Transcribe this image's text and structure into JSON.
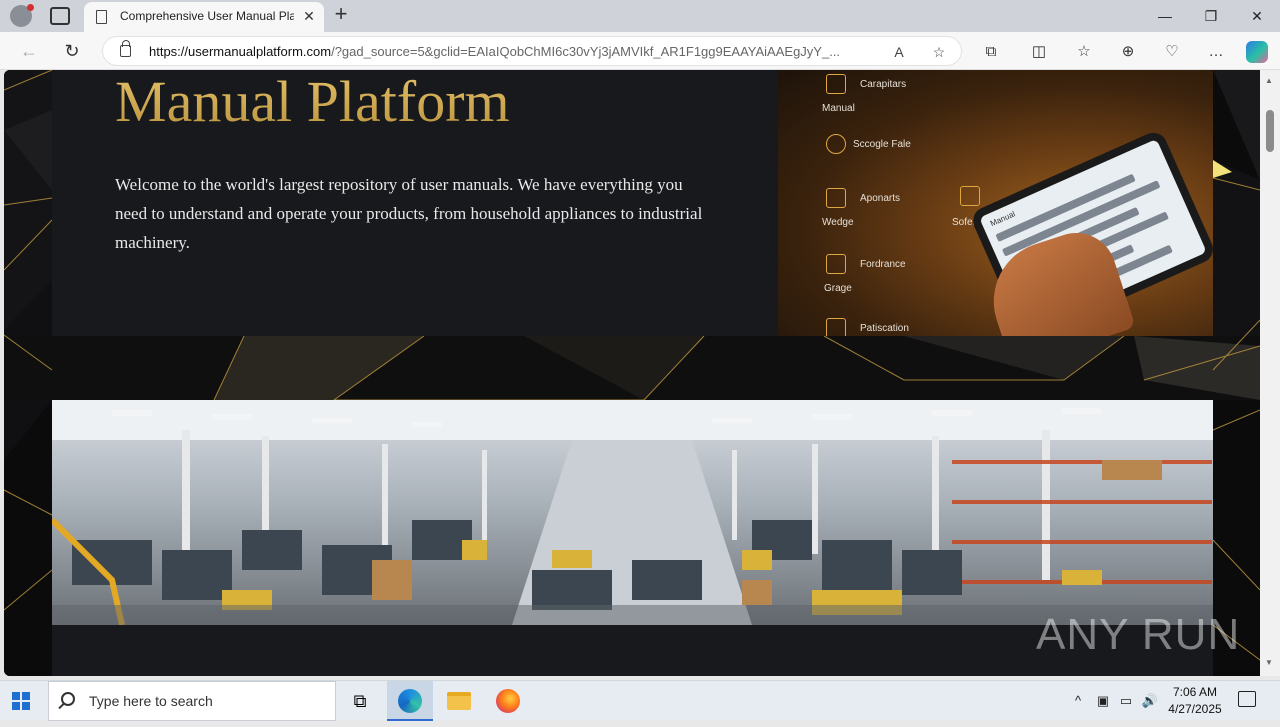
{
  "browser": {
    "tab_title": "Comprehensive User Manual Platform",
    "tab_close": "✕",
    "new_tab": "+",
    "url_host": "https://usermanualplatform.com",
    "url_rest": "/?gad_source=5&gclid=EAIaIQobChMI6c30vYj3jAMVIkf_AR1F1gg9EAAYAiAAEgJyY_...",
    "window": {
      "minimize": "—",
      "restore": "❐",
      "close": "✕"
    },
    "nav": {
      "back": "←",
      "refresh": "↻"
    },
    "url_icons": {
      "read_aloud": "A",
      "favorite": "☆"
    },
    "tools": {
      "extensions": "⧉",
      "split": "◫",
      "favorites": "☆",
      "collections": "⊕",
      "performance": "♡",
      "more": "…"
    }
  },
  "hero": {
    "title": "Manual Platform",
    "description": "Welcome to the world's largest repository of user manuals. We have everything you need to understand and operate your products, from household appliances to industrial machinery."
  },
  "tablet_image": {
    "features": [
      {
        "label_a": "Carapitars",
        "label_b": "Manual",
        "icon": "manual-icon"
      },
      {
        "label_a": "Sccogle Fale",
        "label_b": "",
        "icon": "gear-icon"
      },
      {
        "label_a": "Aponarts",
        "label_b": "Wedge",
        "icon": "box-icon"
      },
      {
        "label_a": "",
        "label_b": "Sofeloy",
        "icon": "info-icon"
      },
      {
        "label_a": "Fordrance",
        "label_b": "Grage",
        "icon": "wrench-icon"
      },
      {
        "label_a": "Patiscation",
        "label_b": "",
        "icon": "calendar-icon"
      }
    ],
    "screen_heading": "Manual"
  },
  "watermark": "ANY RUN",
  "taskbar": {
    "search_placeholder": "Type here to search",
    "time": "7:06 AM",
    "date": "4/27/2025",
    "tray": {
      "chevron": "^",
      "volume": "🔊"
    }
  },
  "colors": {
    "gold": "#d8b45a",
    "hero_bg": "#17191c",
    "page_bg": "#0d0d0e"
  }
}
